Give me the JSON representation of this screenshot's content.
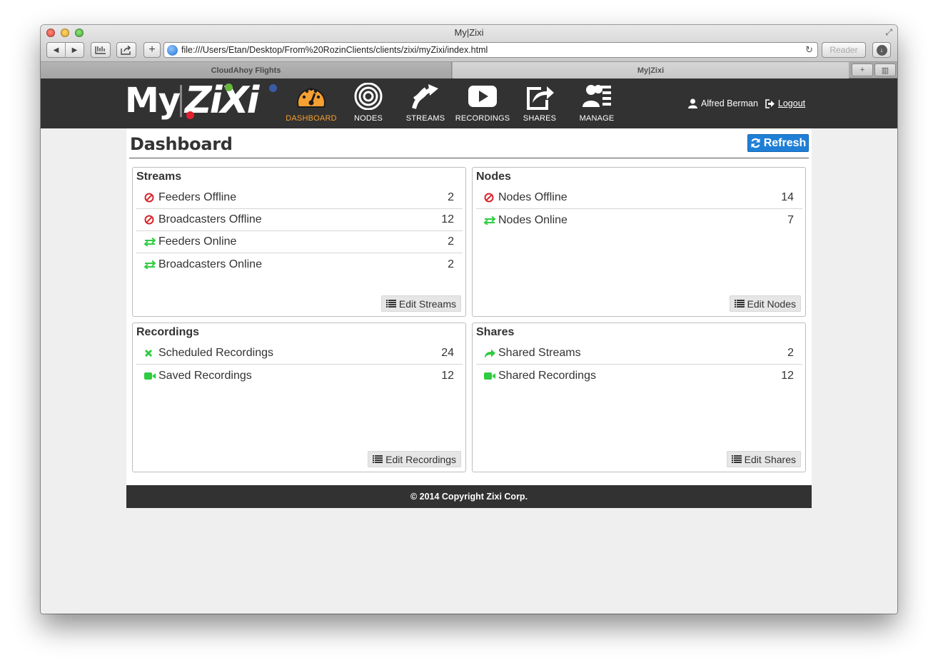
{
  "browser": {
    "window_title": "My|Zixi",
    "url": "file:///Users/Etan/Desktop/From%20RozinClients/clients/zixi/myZixi/index.html",
    "reader_label": "Reader",
    "tabs": [
      {
        "label": "CloudAhoy Flights",
        "active": false
      },
      {
        "label": "My|Zixi",
        "active": true
      }
    ]
  },
  "app": {
    "logo_my": "My",
    "logo_zixi": "ZiXi",
    "nav": [
      {
        "label": "DASHBOARD",
        "icon": "speedometer-icon",
        "active": true
      },
      {
        "label": "NODES",
        "icon": "target-icon",
        "active": false
      },
      {
        "label": "STREAMS",
        "icon": "streams-arrow-icon",
        "active": false
      },
      {
        "label": "RECORDINGS",
        "icon": "play-icon",
        "active": false
      },
      {
        "label": "SHARES",
        "icon": "share-icon",
        "active": false
      },
      {
        "label": "MANAGE",
        "icon": "users-manage-icon",
        "active": false
      }
    ],
    "user": {
      "name": "Alfred Berman",
      "logout_label": "Logout"
    },
    "accent_color": "#f5a031",
    "nav_bg": "#323232"
  },
  "dashboard": {
    "title": "Dashboard",
    "refresh_label": "Refresh",
    "panels": {
      "streams": {
        "title": "Streams",
        "rows": [
          {
            "icon": "ban-icon",
            "label": "Feeders Offline",
            "count": "2"
          },
          {
            "icon": "exchange-icon",
            "label": "Broadcasters Offline",
            "count": "12"
          },
          {
            "icon": "exchange-icon",
            "label": "Feeders Online",
            "count": "2"
          },
          {
            "icon": "exchange-icon",
            "label": "Broadcasters Online",
            "count": "2"
          }
        ],
        "edit_label": "Edit Streams"
      },
      "nodes": {
        "title": "Nodes",
        "rows": [
          {
            "icon": "ban-icon",
            "label": "Nodes Offline",
            "count": "14"
          },
          {
            "icon": "exchange-icon",
            "label": "Nodes Online",
            "count": "7"
          }
        ],
        "edit_label": "Edit Nodes"
      },
      "recordings": {
        "title": "Recordings",
        "rows": [
          {
            "icon": "x-icon",
            "label": "Scheduled Recordings",
            "count": "24"
          },
          {
            "icon": "video-camera-icon",
            "label": "Saved Recordings",
            "count": "12"
          }
        ],
        "edit_label": "Edit Recordings"
      },
      "shares": {
        "title": "Shares",
        "rows": [
          {
            "icon": "share-arrow-icon",
            "label": "Shared Streams",
            "count": "2"
          },
          {
            "icon": "video-camera-icon",
            "label": "Shared Recordings",
            "count": "12"
          }
        ],
        "edit_label": "Edit Shares"
      }
    }
  },
  "footer": {
    "text": "© 2014 Copyright Zixi Corp."
  },
  "colors": {
    "offline_red": "#d8262d",
    "online_green": "#2ecc40",
    "refresh_blue": "#1f7fd6"
  }
}
